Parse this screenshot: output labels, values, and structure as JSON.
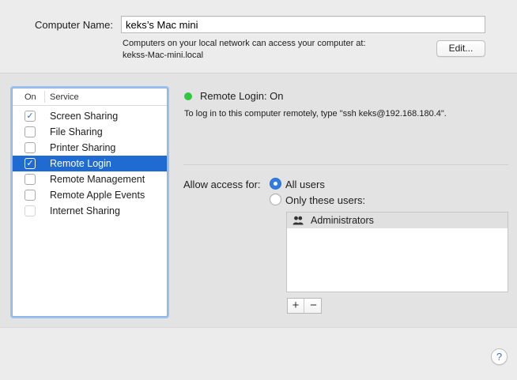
{
  "computer_name": {
    "label": "Computer Name:",
    "value": "keks’s Mac mini",
    "description_line1": "Computers on your local network can access your computer at:",
    "description_line2": "kekss-Mac-mini.local",
    "edit_button": "Edit..."
  },
  "services": {
    "header_on": "On",
    "header_service": "Service",
    "items": [
      {
        "label": "Screen Sharing",
        "checked": true,
        "selected": false,
        "enabled": true
      },
      {
        "label": "File Sharing",
        "checked": false,
        "selected": false,
        "enabled": true
      },
      {
        "label": "Printer Sharing",
        "checked": false,
        "selected": false,
        "enabled": true
      },
      {
        "label": "Remote Login",
        "checked": true,
        "selected": true,
        "enabled": true
      },
      {
        "label": "Remote Management",
        "checked": false,
        "selected": false,
        "enabled": true
      },
      {
        "label": "Remote Apple Events",
        "checked": false,
        "selected": false,
        "enabled": true
      },
      {
        "label": "Internet Sharing",
        "checked": false,
        "selected": false,
        "enabled": false
      }
    ]
  },
  "detail": {
    "status": "Remote Login: On",
    "status_color": "#2fc840",
    "hint": "To log in to this computer remotely, type \"ssh keks@192.168.180.4\".",
    "access_label": "Allow access for:",
    "option_all": "All users",
    "option_only": "Only these users:",
    "selected_option": "All users",
    "users": [
      {
        "name": "Administrators",
        "icon": "group-icon"
      }
    ],
    "add_label": "+",
    "remove_label": "−"
  },
  "help_label": "?",
  "colors": {
    "selection": "#1f6bd1",
    "accent": "#2f7de1"
  }
}
